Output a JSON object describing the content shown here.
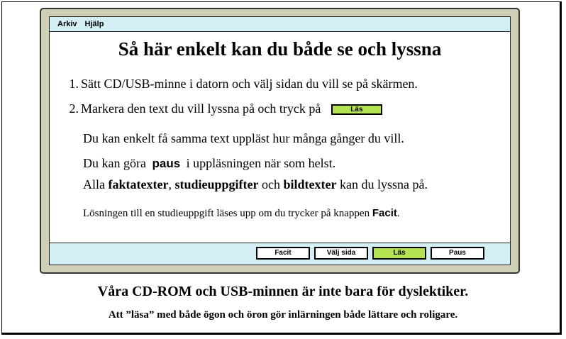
{
  "menu": {
    "items": [
      "Arkiv",
      "Hjälp"
    ]
  },
  "title": "Så här enkelt kan du både se och lyssna",
  "steps": [
    {
      "num": "1.",
      "text": "Sätt CD/USB-minne i datorn och välj sidan du vill se på skärmen."
    },
    {
      "num": "2.",
      "text": "Markera den text du vill lyssna på och tryck på",
      "button": "Läs"
    }
  ],
  "lines": {
    "l1": "Du kan enkelt få samma text uppläst hur många gånger du vill.",
    "l2_pre": "Du kan göra",
    "l2_bold": "paus",
    "l2_post": "i uppläsningen när som helst.",
    "l3_pre": "Alla",
    "l3_b1": "faktatexter",
    "l3_sep": ",",
    "l3_b2": "studieuppgifter",
    "l3_mid": "och",
    "l3_b3": "bildtexter",
    "l3_post": "kan du lyssna på.",
    "l4_pre": "Lösningen till en studieuppgift läses upp om du trycker på knappen",
    "l4_bold": "Facit",
    "l4_post": "."
  },
  "toolbar": {
    "buttons": [
      {
        "label": "Facit",
        "active": false
      },
      {
        "label": "Välj sida",
        "active": false
      },
      {
        "label": "Läs",
        "active": true
      },
      {
        "label": "Paus",
        "active": false
      }
    ]
  },
  "colors": {
    "screen_bar": "#d3eef5",
    "monitor": "#cfceb6",
    "las_green": "#b5e253"
  },
  "footer": {
    "line1": "Våra CD-ROM och USB-minnen är inte bara för dyslektiker.",
    "line2": "Att ”läsa” med både ögon och öron gör inlärningen både lättare och roligare."
  }
}
